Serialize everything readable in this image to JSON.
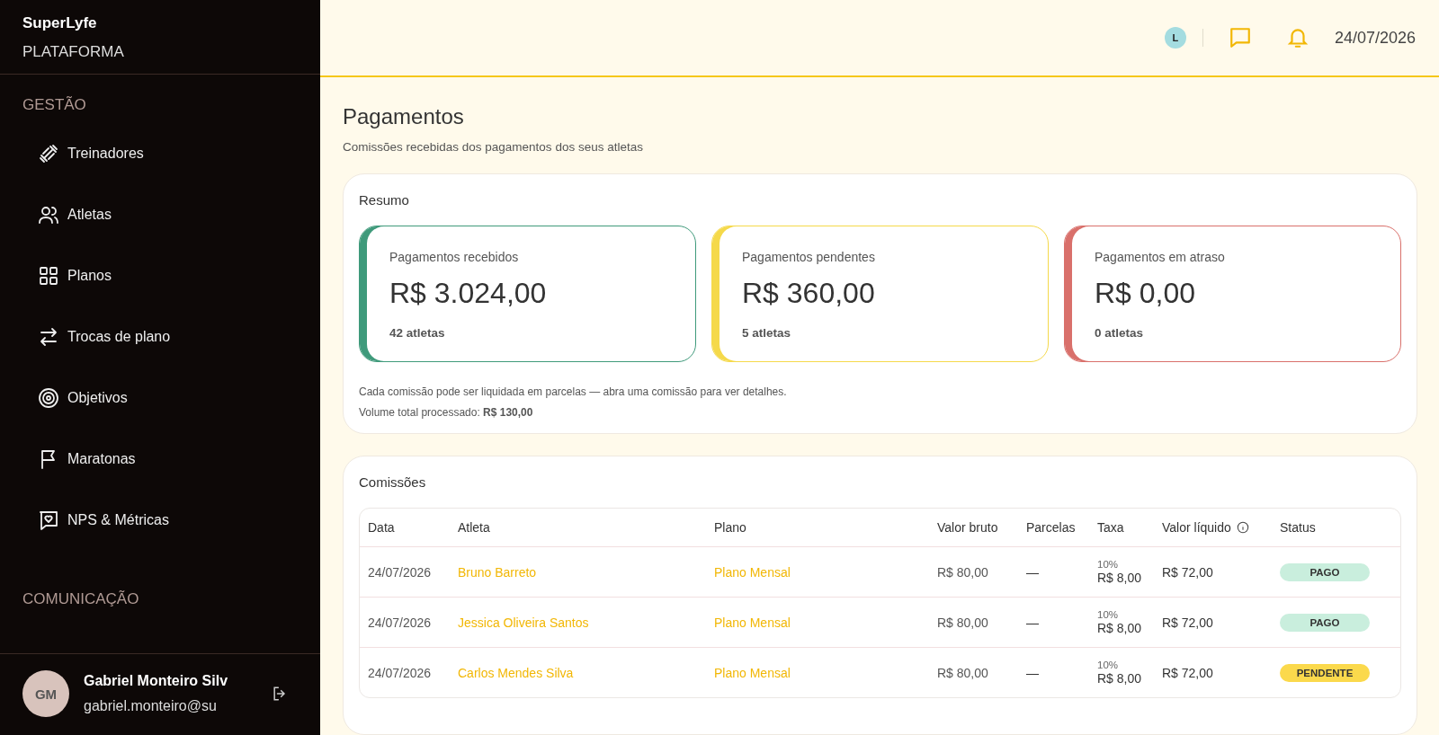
{
  "sidebar": {
    "brand": "SuperLyfe",
    "subtitle": "PLATAFORMA",
    "sections": [
      {
        "title": "GESTÃO",
        "items": [
          {
            "label": "Treinadores",
            "kind": "dumbbell"
          },
          {
            "label": "Atletas",
            "kind": "users"
          },
          {
            "label": "Planos",
            "kind": "grid"
          },
          {
            "label": "Trocas de plano",
            "kind": "swap"
          },
          {
            "label": "Objetivos",
            "kind": "target"
          },
          {
            "label": "Maratonas",
            "kind": "flag"
          },
          {
            "label": "NPS & Métricas",
            "kind": "heartchat"
          }
        ]
      },
      {
        "title": "COMUNICAÇÃO"
      }
    ],
    "user": {
      "initials": "GM",
      "name": "Gabriel Monteiro Silv",
      "email": "gabriel.monteiro@su"
    }
  },
  "header": {
    "avatar": "L",
    "date": "24/07/2026"
  },
  "page": {
    "title": "Pagamentos",
    "subtitle": "Comissões recebidas dos pagamentos dos seus atletas"
  },
  "summary": {
    "title": "Resumo",
    "cards": [
      {
        "label": "Pagamentos recebidos",
        "value": "R$ 3.024,00",
        "count": "42 atletas",
        "color": "#3f9a7b"
      },
      {
        "label": "Pagamentos pendentes",
        "value": "R$ 360,00",
        "count": "5 atletas",
        "color": "#f5d94a"
      },
      {
        "label": "Pagamentos em atraso",
        "value": "R$ 0,00",
        "count": "0 atletas",
        "color": "#d9706b"
      }
    ],
    "note": "Cada comissão pode ser liquidada em parcelas — abra uma comissão para ver detalhes.",
    "total": "Volume total processado: **R$ 130,00**"
  },
  "commissions": {
    "title": "Comissões",
    "columns": [
      "Data",
      "Atleta",
      "Plano",
      "Valor bruto",
      "Parcelas",
      "Taxa",
      "Valor líquido",
      "Status"
    ],
    "rows": [
      {
        "date": "24/07/2026",
        "athlete": "Bruno Barreto",
        "plan": "Plano Mensal",
        "gross": "R$ 80,00",
        "installments": "—",
        "fee_rate": "10%",
        "fee": "R$ 8,00",
        "net": "R$ 72,00",
        "status": "PAGO",
        "kind": "paid"
      },
      {
        "date": "24/07/2026",
        "athlete": "Jessica Oliveira Santos",
        "plan": "Plano Mensal",
        "gross": "R$ 80,00",
        "installments": "—",
        "fee_rate": "10%",
        "fee": "R$ 8,00",
        "net": "R$ 72,00",
        "status": "PAGO",
        "kind": "paid"
      },
      {
        "date": "24/07/2026",
        "athlete": "Carlos Mendes Silva",
        "plan": "Plano Mensal",
        "gross": "R$ 80,00",
        "installments": "—",
        "fee_rate": "10%",
        "fee": "R$ 8,00",
        "net": "R$ 72,00",
        "status": "PENDENTE",
        "kind": "pending"
      }
    ]
  }
}
